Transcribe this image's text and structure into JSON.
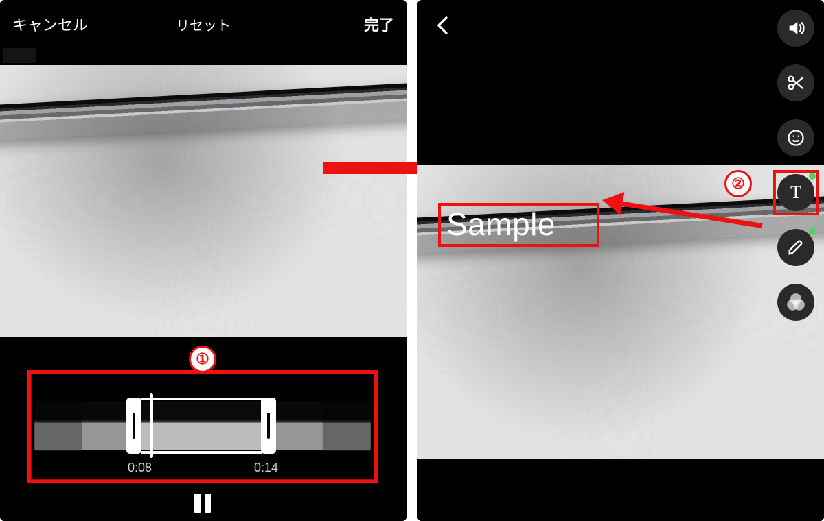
{
  "left": {
    "header": {
      "cancel": "キャンセル",
      "reset": "リセット",
      "done": "完了"
    },
    "trim": {
      "start": "0:08",
      "end": "0:14"
    }
  },
  "right": {
    "overlay_text": "Sample"
  },
  "callouts": {
    "one": "①",
    "two": "②"
  }
}
